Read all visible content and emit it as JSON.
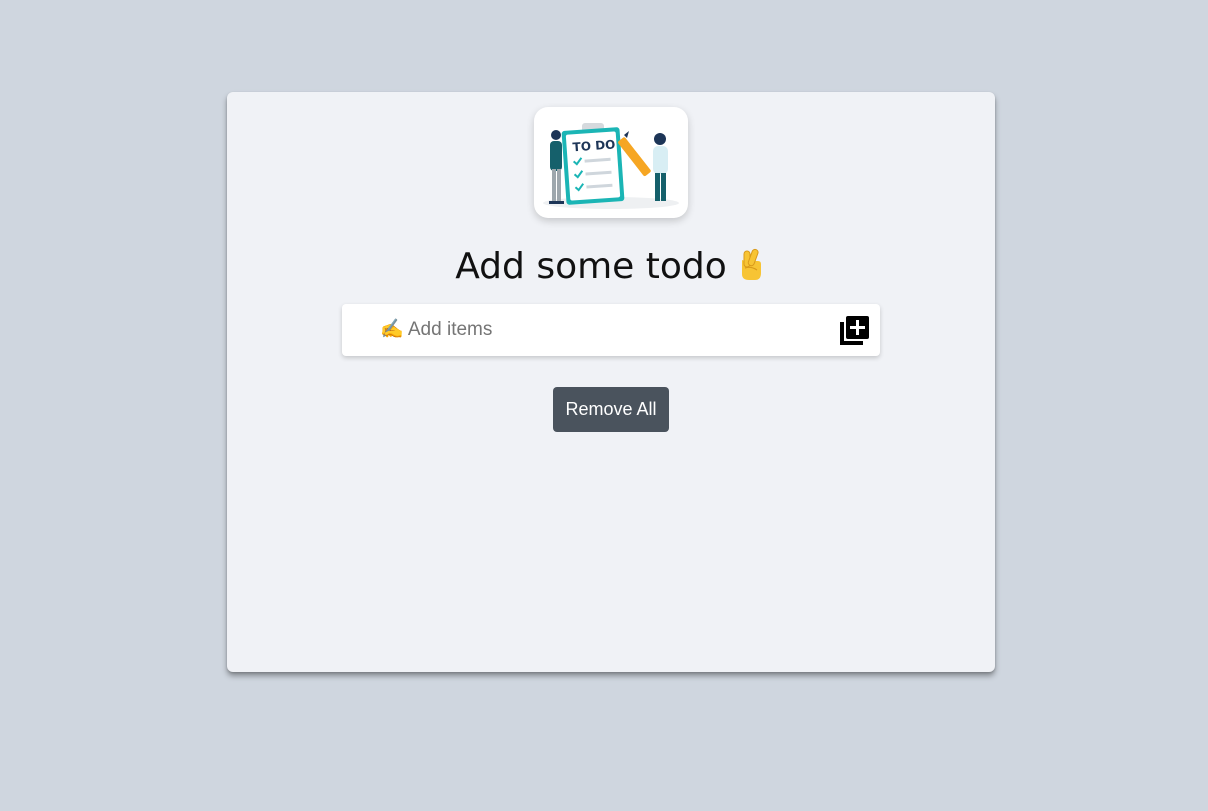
{
  "logo": {
    "alt": "todo illustration",
    "badge_text": "TO DO"
  },
  "header": {
    "title": "Add some todo",
    "emoji": "crossed-fingers"
  },
  "input": {
    "icon": "writing-hand-icon",
    "placeholder": "✍ Add items",
    "value": ""
  },
  "add_button": {
    "icon": "library-add-icon"
  },
  "remove_all": {
    "label": "Remove All"
  },
  "colors": {
    "background": "#cfd6df",
    "card": "#f0f2f6",
    "button": "#4a535d",
    "accent_teal": "#1bb5b5",
    "accent_orange": "#f6a623"
  }
}
